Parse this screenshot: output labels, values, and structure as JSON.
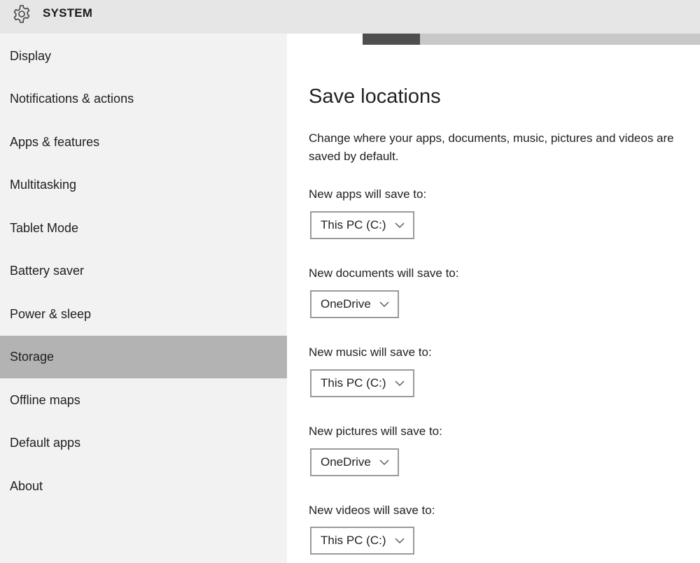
{
  "window": {
    "title": "SYSTEM",
    "icon": "gear-icon"
  },
  "sidebar": {
    "items": [
      {
        "label": "Display",
        "selected": false
      },
      {
        "label": "Notifications & actions",
        "selected": false
      },
      {
        "label": "Apps & features",
        "selected": false
      },
      {
        "label": "Multitasking",
        "selected": false
      },
      {
        "label": "Tablet Mode",
        "selected": false
      },
      {
        "label": "Battery saver",
        "selected": false
      },
      {
        "label": "Power & sleep",
        "selected": false
      },
      {
        "label": "Storage",
        "selected": true
      },
      {
        "label": "Offline maps",
        "selected": false
      },
      {
        "label": "Default apps",
        "selected": false
      },
      {
        "label": "About",
        "selected": false
      }
    ]
  },
  "storage_usage": {
    "fill_fraction_visible": 0.17,
    "fill_color": "#4e4e4e",
    "track_color": "#c8c8c8"
  },
  "main": {
    "heading": "Save locations",
    "description": "Change where your apps, documents, music, pictures and videos are saved by default.",
    "settings": [
      {
        "label": "New apps will save to:",
        "value": "This PC (C:)"
      },
      {
        "label": "New documents will save to:",
        "value": "OneDrive"
      },
      {
        "label": "New music will save to:",
        "value": "This PC (C:)"
      },
      {
        "label": "New pictures will save to:",
        "value": "OneDrive"
      },
      {
        "label": "New videos will save to:",
        "value": "This PC (C:)"
      }
    ]
  },
  "colors": {
    "selected_nav_bg": "#b3b3b3",
    "sidebar_bg": "#f2f2f2",
    "titlebar_bg": "#e6e6e6",
    "dropdown_border": "#9a9a9a"
  }
}
